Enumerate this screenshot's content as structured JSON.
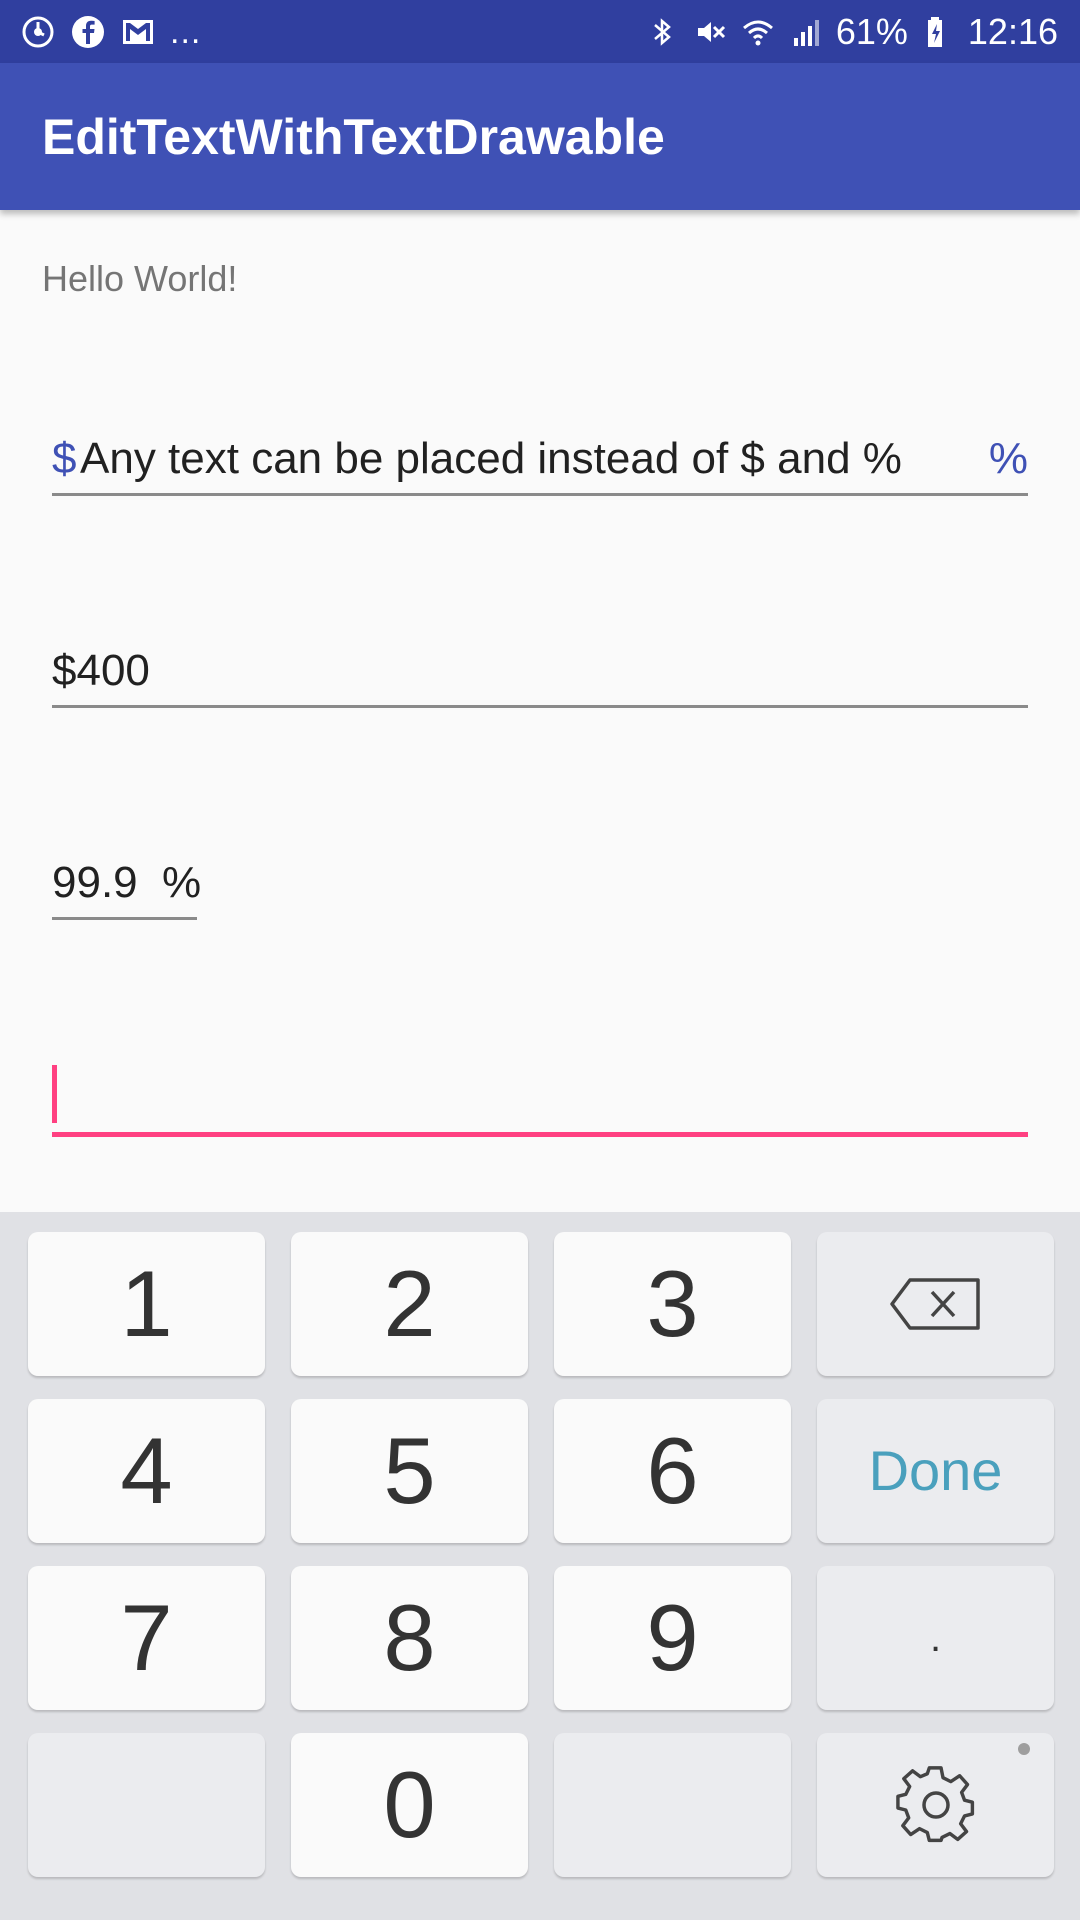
{
  "status_bar": {
    "left_icons": [
      "sync-icon",
      "facebook-icon",
      "gmail-icon"
    ],
    "more_indicator": "...",
    "right_icons": [
      "bluetooth-icon",
      "mute-icon",
      "wifi-icon",
      "signal-icon"
    ],
    "battery_percent": "61%",
    "battery_icon": "battery-charging-icon",
    "time": "12:16"
  },
  "app_bar": {
    "title": "EditTextWithTextDrawable"
  },
  "content": {
    "hello_text": "Hello World!",
    "field1": {
      "prefix": "$",
      "value": "Any text can be placed instead of $ and %",
      "suffix": "%"
    },
    "field2": {
      "value": "$400"
    },
    "field3": {
      "value": "99.9",
      "suffix": "%"
    },
    "field4": {
      "value": ""
    }
  },
  "keyboard": {
    "row1": [
      "1",
      "2",
      "3"
    ],
    "row2": [
      "4",
      "5",
      "6"
    ],
    "row3": [
      "7",
      "8",
      "9"
    ],
    "row4": [
      "0"
    ],
    "done_label": "Done",
    "dot_label": ".",
    "backspace_icon": "backspace-icon",
    "settings_icon": "gear-icon"
  },
  "colors": {
    "status_bar": "#303f9f",
    "app_bar": "#3f51b5",
    "accent": "#ff4081",
    "drawable_text": "#3f51b5",
    "done_text": "#4aa0bd"
  }
}
